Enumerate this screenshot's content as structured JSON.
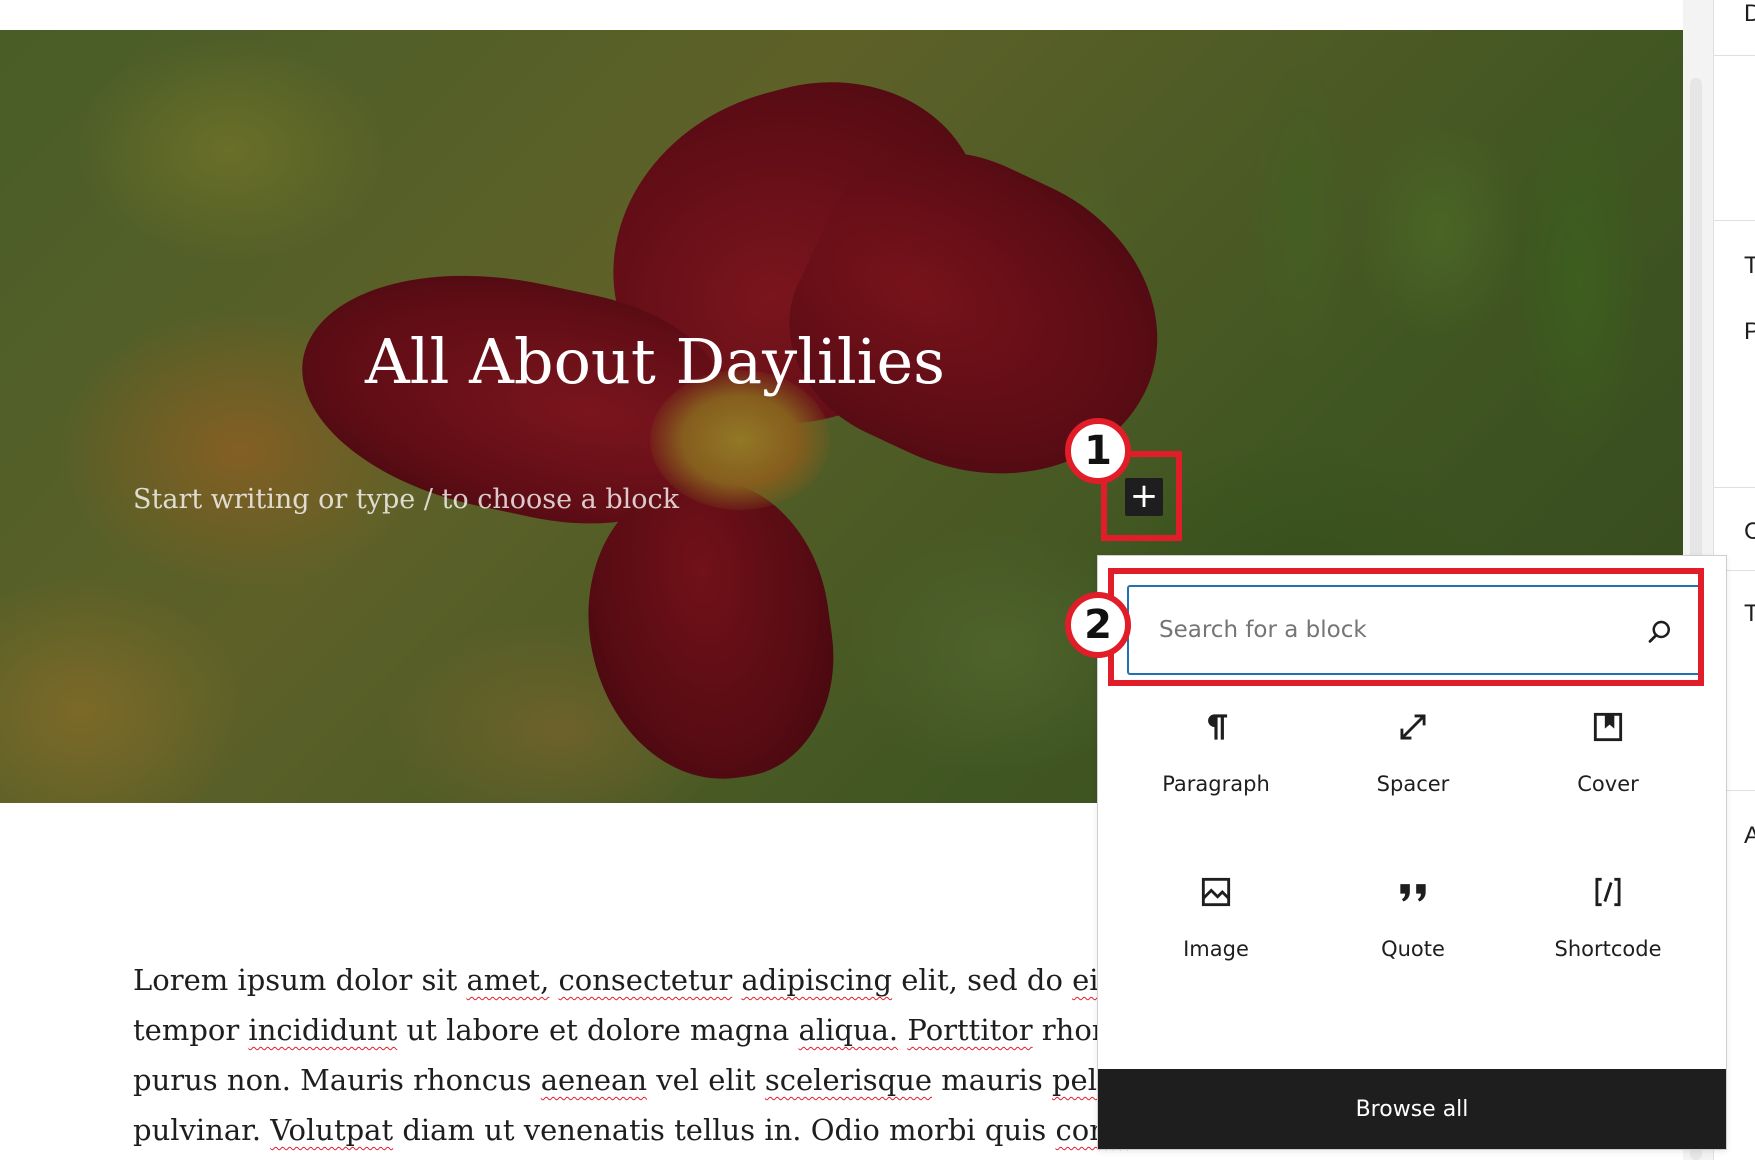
{
  "cover": {
    "title": "All About Daylilies",
    "placeholder": "Start writing or type / to choose a block"
  },
  "inserter_button": {
    "icon": "plus-icon",
    "glyph": "+"
  },
  "callouts": [
    {
      "number": "1"
    },
    {
      "number": "2"
    }
  ],
  "inserter": {
    "search_placeholder": "Search for a block",
    "blocks": [
      {
        "label": "Paragraph",
        "icon": "paragraph-icon"
      },
      {
        "label": "Spacer",
        "icon": "spacer-icon"
      },
      {
        "label": "Cover",
        "icon": "cover-icon"
      },
      {
        "label": "Image",
        "icon": "image-icon"
      },
      {
        "label": "Quote",
        "icon": "quote-icon"
      },
      {
        "label": "Shortcode",
        "icon": "shortcode-icon"
      }
    ],
    "browse_all": "Browse all"
  },
  "body_lines": [
    "Lorem ipsum dolor sit amet, consectetur adipiscing elit, sed do eiusmo",
    "tempor incididunt ut labore et dolore magna aliqua. Porttitor rhoncus",
    "purus non. Mauris rhoncus aenean vel elit scelerisque mauris pellente",
    "pulvinar. Volutpat diam ut venenatis tellus in. Odio morbi quis commo"
  ],
  "sidebar_letters": [
    "D",
    "T",
    "P",
    "C",
    "T",
    "A"
  ],
  "colors": {
    "accent": "#2271b1",
    "callout": "#e11d2a",
    "dark": "#1e1e1e"
  }
}
